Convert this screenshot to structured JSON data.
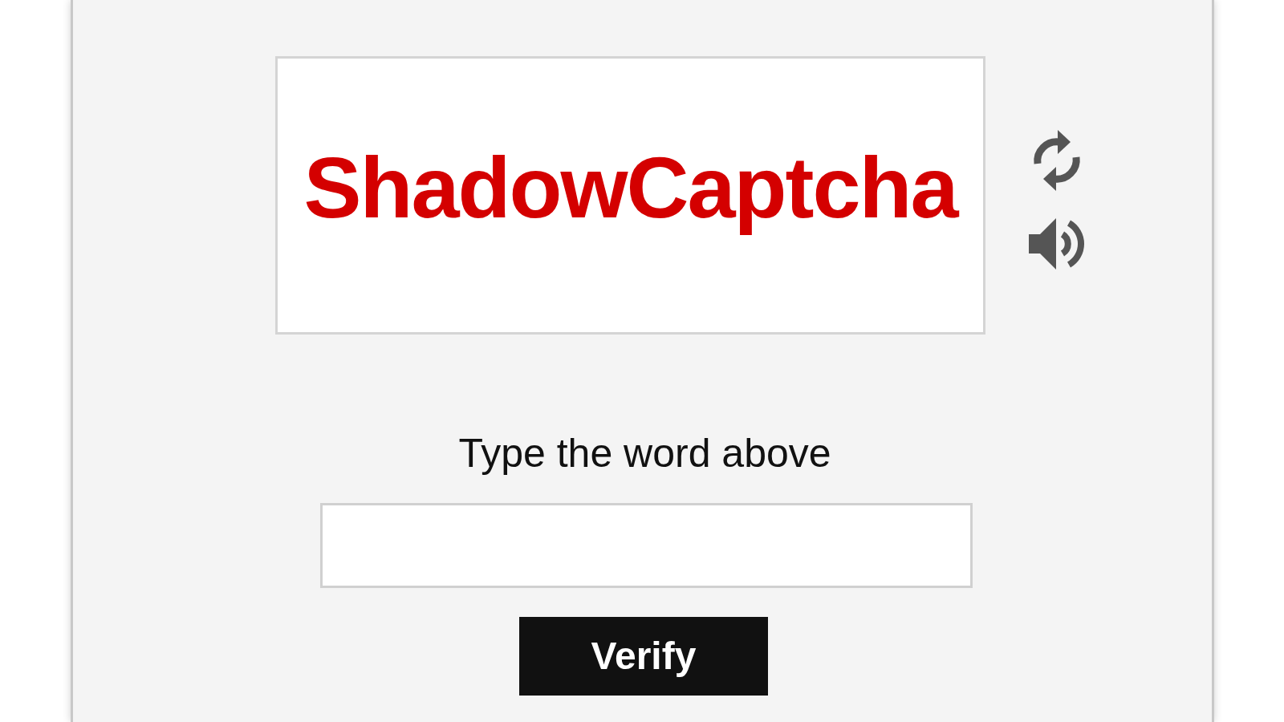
{
  "captcha": {
    "word": "ShadowCaptcha"
  },
  "prompt": "Type the word above",
  "button": {
    "label": "Verify"
  }
}
